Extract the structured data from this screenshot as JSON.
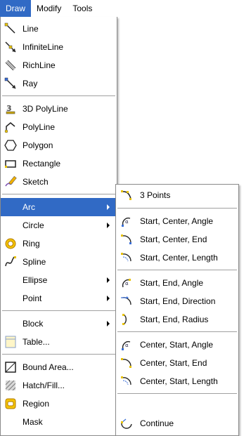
{
  "menubar": {
    "items": [
      "Draw",
      "Modify",
      "Tools"
    ]
  },
  "draw_menu": {
    "items": [
      {
        "label": "Line",
        "icon": "line-icon"
      },
      {
        "label": "InfiniteLine",
        "icon": "infinite-line-icon"
      },
      {
        "label": "RichLine",
        "icon": "rich-line-icon"
      },
      {
        "label": "Ray",
        "icon": "ray-icon"
      },
      {
        "label": "3D PolyLine",
        "icon": "3d-polyline-icon"
      },
      {
        "label": "PolyLine",
        "icon": "polyline-icon"
      },
      {
        "label": "Polygon",
        "icon": "polygon-icon"
      },
      {
        "label": "Rectangle",
        "icon": "rectangle-icon"
      },
      {
        "label": "Sketch",
        "icon": "sketch-icon"
      },
      {
        "label": "Arc",
        "icon": "",
        "submenu": true,
        "selected": true
      },
      {
        "label": "Circle",
        "icon": "",
        "submenu": true
      },
      {
        "label": "Ring",
        "icon": "ring-icon"
      },
      {
        "label": "Spline",
        "icon": "spline-icon"
      },
      {
        "label": "Ellipse",
        "icon": "",
        "submenu": true
      },
      {
        "label": "Point",
        "icon": "",
        "submenu": true
      },
      {
        "label": "Block",
        "icon": "",
        "submenu": true
      },
      {
        "label": "Table...",
        "icon": "table-icon"
      },
      {
        "label": "Bound Area...",
        "icon": "bound-area-icon"
      },
      {
        "label": "Hatch/Fill...",
        "icon": "hatch-fill-icon"
      },
      {
        "label": "Region",
        "icon": "region-icon"
      },
      {
        "label": "Mask",
        "icon": ""
      }
    ]
  },
  "arc_submenu": {
    "items": [
      {
        "label": "3 Points",
        "icon": "arc-3-points-icon"
      },
      {
        "label": "Start, Center, Angle",
        "icon": "arc-start-center-angle-icon"
      },
      {
        "label": "Start, Center, End",
        "icon": "arc-start-center-end-icon"
      },
      {
        "label": "Start, Center, Length",
        "icon": "arc-start-center-length-icon"
      },
      {
        "label": "Start, End, Angle",
        "icon": "arc-start-end-angle-icon"
      },
      {
        "label": "Start, End, Direction",
        "icon": "arc-start-end-direction-icon"
      },
      {
        "label": "Start, End, Radius",
        "icon": "arc-start-end-radius-icon"
      },
      {
        "label": "Center, Start, Angle",
        "icon": "arc-center-start-angle-icon"
      },
      {
        "label": "Center, Start, End",
        "icon": "arc-center-start-end-icon"
      },
      {
        "label": "Center, Start, Length",
        "icon": "arc-center-start-length-icon"
      },
      {
        "label": "Continue",
        "icon": "arc-continue-icon"
      }
    ]
  },
  "colors": {
    "highlight": "#316ac5",
    "menu_border": "#8a8a8a",
    "separator": "#a0a0a0"
  }
}
